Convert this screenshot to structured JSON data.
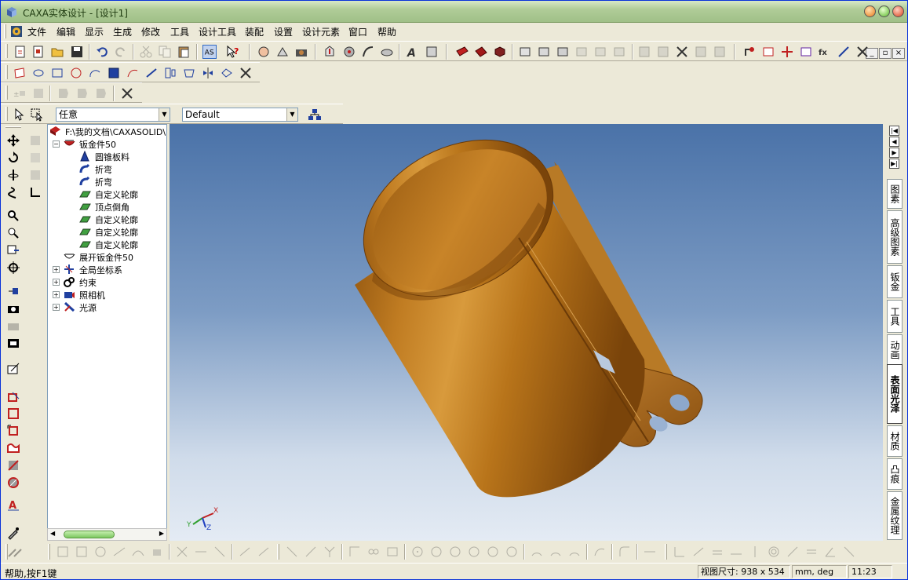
{
  "window": {
    "title": "CAXA实体设计 - [设计1]"
  },
  "menu": [
    "文件",
    "编辑",
    "显示",
    "生成",
    "修改",
    "工具",
    "设计工具",
    "装配",
    "设置",
    "设计元素",
    "窗口",
    "帮助"
  ],
  "selector": {
    "filter_value": "任意",
    "config_value": "Default"
  },
  "tree": {
    "root": "F:\\我的文档\\CAXASOLID\\",
    "part": "钣金件50",
    "features": [
      "圆锥板料",
      "折弯",
      "折弯",
      "自定义轮廓",
      "顶点倒角",
      "自定义轮廓",
      "自定义轮廓",
      "自定义轮廓"
    ],
    "unfold": "展开钣金件50",
    "groups": [
      "全局坐标系",
      "约束",
      "照相机",
      "光源"
    ]
  },
  "right_tabs": [
    "图素",
    "高级图素",
    "钣金",
    "工具",
    "动画",
    "表面光泽",
    "材质",
    "凸痕",
    "金属纹理"
  ],
  "active_right_tab": "表面光泽",
  "axis_labels": {
    "x": "X",
    "y": "Y",
    "z": "Z"
  },
  "status": {
    "help": "帮助,按F1键",
    "view_size": "视图尺寸: 938 x 534",
    "units": "mm, deg",
    "time": "11:23"
  },
  "colors": {
    "part": "#b8741a",
    "viewport_top": "#4a72a8",
    "viewport_bottom": "#e4ebf4"
  }
}
